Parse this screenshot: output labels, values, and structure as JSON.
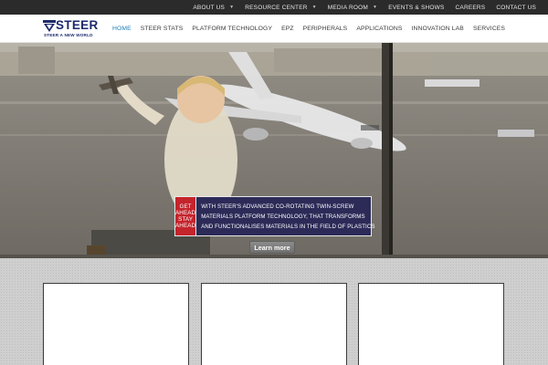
{
  "topbar": {
    "items": [
      {
        "label": "ABOUT US",
        "dropdown": true
      },
      {
        "label": "RESOURCE CENTER",
        "dropdown": true
      },
      {
        "label": "MEDIA ROOM",
        "dropdown": true
      },
      {
        "label": "EVENTS & SHOWS",
        "dropdown": false
      },
      {
        "label": "CAREERS",
        "dropdown": false
      },
      {
        "label": "CONTACT US",
        "dropdown": false
      }
    ]
  },
  "brand": {
    "name": "STEER",
    "tagline": "STEER A NEW WORLD",
    "color": "#1c2a6d"
  },
  "nav": {
    "items": [
      {
        "label": "HOME",
        "active": true
      },
      {
        "label": "STEER STATS",
        "active": false
      },
      {
        "label": "PLATFORM TECHNOLOGY",
        "active": false
      },
      {
        "label": "EPZ",
        "active": false
      },
      {
        "label": "PERIPHERALS",
        "active": false
      },
      {
        "label": "APPLICATIONS",
        "active": false
      },
      {
        "label": "INNOVATION LAB",
        "active": false
      },
      {
        "label": "SERVICES",
        "active": false
      }
    ],
    "active_color": "#1f7fb5"
  },
  "hero": {
    "cta_lines": [
      "GET",
      "AHEAD",
      "STAY",
      "AHEAD"
    ],
    "body_lines": [
      "WITH STEER'S ADVANCED CO-ROTATING TWIN-SCREW",
      "MATERIALS PLATFORM TECHNOLOGY, THAT TRANSFORMS",
      "AND FUNCTIONALISES MATERIALS IN THE FIELD OF PLASTICS"
    ],
    "button_label": "Learn more",
    "accent_red": "#c4242c",
    "panel_navy": "#2c2b58"
  },
  "cards": [
    {},
    {},
    {}
  ]
}
